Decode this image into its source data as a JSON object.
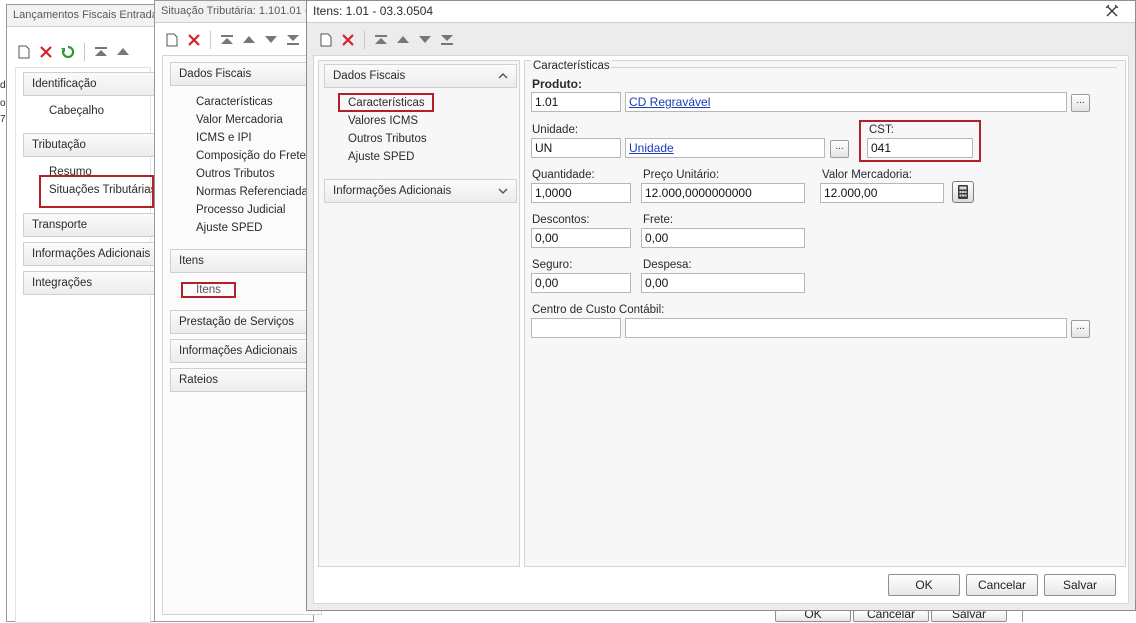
{
  "win1": {
    "title": "Lançamentos Fiscais Entrada",
    "groups": {
      "identificacao": "Identificação",
      "cabecalho": "Cabeçalho",
      "tributacao": "Tributação",
      "resumo": "Resumo",
      "situacoes": "Situações Tributárias",
      "transporte": "Transporte",
      "info_adicionais": "Informações Adicionais",
      "integracoes": "Integrações"
    },
    "edge_chars": [
      "d",
      "o",
      "7"
    ]
  },
  "win2": {
    "title": "Situação Tributária: 1.101.01 - ...",
    "groups": {
      "dados_fiscais": "Dados Fiscais",
      "itens": "Itens",
      "prestacao": "Prestação de Serviços",
      "info_adicionais": "Informações Adicionais",
      "rateios": "Rateios"
    },
    "dados_fiscais_items": [
      "Características",
      "Valor Mercadoria",
      "ICMS e IPI",
      "Composição do Frete",
      "Outros Tributos",
      "Normas Referenciadas",
      "Processo Judicial",
      "Ajuste SPED"
    ],
    "itens_item": "Itens",
    "behind_buttons": [
      "OK",
      "Cancelar",
      "Salvar"
    ]
  },
  "win3": {
    "title": "Itens: 1.01 - 03.3.0504",
    "close_glyph": "✕",
    "nav": {
      "dados_fiscais": "Dados Fiscais",
      "items": [
        "Características",
        "Valores ICMS",
        "Outros Tributos",
        "Ajuste SPED"
      ],
      "info_adicionais": "Informações Adicionais"
    },
    "section_title": "Características",
    "form": {
      "produto_label": "Produto:",
      "produto_code": "1.01",
      "produto_desc": "CD Regravável",
      "unidade_label": "Unidade:",
      "unidade_code": "UN",
      "unidade_desc": "Unidade",
      "cst_label": "CST:",
      "cst_value": "041",
      "quantidade_label": "Quantidade:",
      "quantidade_value": "1,0000",
      "preco_label": "Preço Unitário:",
      "preco_value": "12.000,0000000000",
      "valor_merc_label": "Valor Mercadoria:",
      "valor_merc_value": "12.000,00",
      "descontos_label": "Descontos:",
      "descontos_value": "0,00",
      "frete_label": "Frete:",
      "frete_value": "0,00",
      "seguro_label": "Seguro:",
      "seguro_value": "0,00",
      "despesa_label": "Despesa:",
      "despesa_value": "0,00",
      "centro_label": "Centro de Custo Contábil:",
      "centro_code": "",
      "centro_desc": "",
      "lookup_glyph": "..."
    },
    "buttons": {
      "ok": "OK",
      "cancel": "Cancelar",
      "save": "Salvar"
    }
  },
  "colors": {
    "highlight_red": "#b32028",
    "link_blue": "#1a3cb8",
    "delete_red": "#d3212d",
    "refresh_green": "#2e9a2e"
  },
  "icons": [
    "new-document-icon",
    "delete-icon",
    "refresh-icon",
    "move-first-icon",
    "move-up-icon",
    "move-down-icon",
    "move-last-icon",
    "chevron-up-icon",
    "chevron-down-icon",
    "calculator-icon"
  ]
}
